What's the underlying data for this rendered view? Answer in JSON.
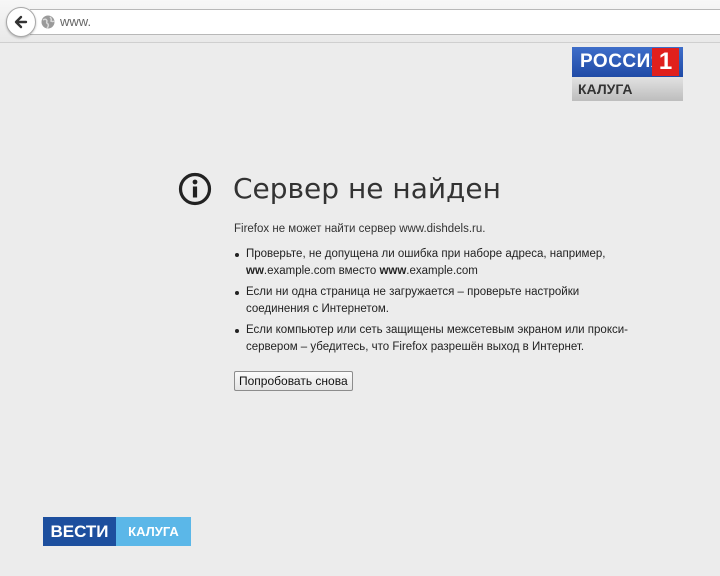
{
  "browser": {
    "url": "www.",
    "back_icon": "back-arrow-icon",
    "site_icon": "globe-icon"
  },
  "tv_logo": {
    "word": "РОССИЯ",
    "number": "1",
    "region": "КАЛУГА"
  },
  "error": {
    "icon": "info-icon",
    "title": "Сервер не найден",
    "description": "Firefox не может найти сервер www.dishdels.ru.",
    "bullets": [
      "Проверьте, не допущена ли ошибка при наборе адреса, например,",
      "ww",
      ".example.com вместо ",
      "www",
      ".example.com",
      "Если ни одна страница не загружается – проверьте настройки соединения с Интернетом.",
      "Если компьютер или сеть защищены межсетевым экраном или прокси-сервером – убедитесь, что Firefox разрешён выход в Интернет."
    ],
    "retry_label": "Попробовать снова"
  },
  "watermark": {
    "left": "ВЕСТИ",
    "right": "КАЛУГА"
  },
  "colors": {
    "page_bg": "#ececec",
    "russia_blue": "#1f4aa6",
    "russia_red": "#e0201d",
    "vesti_dark": "#1d4f9e",
    "vesti_light": "#5bb7e8"
  }
}
